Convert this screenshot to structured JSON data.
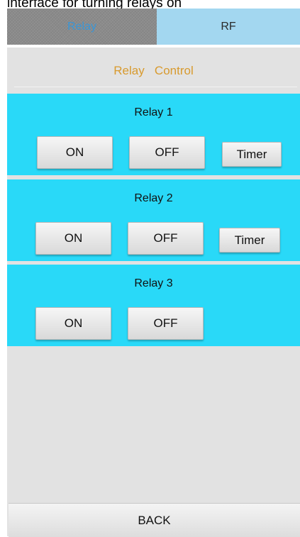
{
  "caption": "interface for turning relays on",
  "tabs": {
    "relay": "Relay",
    "rf": "RF"
  },
  "header": {
    "title": "Relay   Control"
  },
  "relays": [
    {
      "title": "Relay 1",
      "on": "ON",
      "off": "OFF",
      "timer": "Timer"
    },
    {
      "title": "Relay 2",
      "on": "ON",
      "off": "OFF",
      "timer": "Timer"
    },
    {
      "title": "Relay 3",
      "on": "ON",
      "off": "OFF"
    }
  ],
  "footer": {
    "back": "BACK"
  },
  "colors": {
    "panel": "#29d9f8",
    "header_text": "#d89a2e",
    "active_tab_text": "#3a96d6",
    "rf_tab_bg": "#a3d7f0"
  }
}
